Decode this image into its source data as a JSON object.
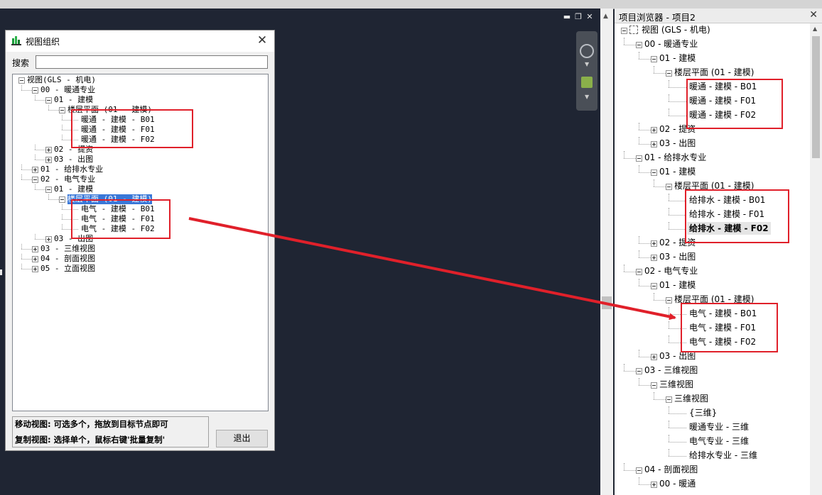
{
  "dialog": {
    "title": "视图组织",
    "close_glyph": "✕",
    "search_label": "搜索",
    "search_value": "",
    "tree": [
      {
        "label": "视图(GLS - 机电)",
        "level": 0,
        "expander": "minus"
      },
      {
        "label": "00 - 暖通专业",
        "level": 1,
        "expander": "minus"
      },
      {
        "label": "01 - 建模",
        "level": 2,
        "expander": "minus"
      },
      {
        "label": "楼层平面 (01 - 建模)",
        "level": 3,
        "expander": "minus"
      },
      {
        "label": "暖通 - 建模 - B01",
        "level": 4,
        "expander": "none"
      },
      {
        "label": "暖通 - 建模 - F01",
        "level": 4,
        "expander": "none"
      },
      {
        "label": "暖通 - 建模 - F02",
        "level": 4,
        "expander": "none"
      },
      {
        "label": "02 - 提资",
        "level": 2,
        "expander": "plus"
      },
      {
        "label": "03 - 出图",
        "level": 2,
        "expander": "plus"
      },
      {
        "label": "01 - 给排水专业",
        "level": 1,
        "expander": "plus"
      },
      {
        "label": "02 - 电气专业",
        "level": 1,
        "expander": "minus"
      },
      {
        "label": "01 - 建模",
        "level": 2,
        "expander": "minus"
      },
      {
        "label": "楼层平面 (01 - 建模)",
        "level": 3,
        "expander": "minus",
        "selected": true
      },
      {
        "label": "电气 - 建模 - B01",
        "level": 4,
        "expander": "none"
      },
      {
        "label": "电气 - 建模 - F01",
        "level": 4,
        "expander": "none"
      },
      {
        "label": "电气 - 建模 - F02",
        "level": 4,
        "expander": "none"
      },
      {
        "label": "03 - 出图",
        "level": 2,
        "expander": "plus"
      },
      {
        "label": "03 - 三维视图",
        "level": 1,
        "expander": "plus"
      },
      {
        "label": "04 - 剖面视图",
        "level": 1,
        "expander": "plus"
      },
      {
        "label": "05 - 立面视图",
        "level": 1,
        "expander": "plus"
      }
    ],
    "info_line1": "移动视图: 可选多个，拖放到目标节点即可",
    "info_line2": "复制视图: 选择单个，鼠标右键'批量复制'",
    "exit_label": "退出"
  },
  "project_browser": {
    "title": "项目浏览器 - 项目2",
    "close_glyph": "✕",
    "tree": [
      {
        "label": "视图 (GLS - 机电)",
        "level": 0,
        "expander": "minus",
        "icon": "views-icon"
      },
      {
        "label": "00 - 暖通专业",
        "level": 1,
        "expander": "minus"
      },
      {
        "label": "01 - 建模",
        "level": 2,
        "expander": "minus"
      },
      {
        "label": "楼层平面 (01 - 建模)",
        "level": 3,
        "expander": "minus"
      },
      {
        "label": "暖通 - 建模 - B01",
        "level": 4,
        "expander": "none"
      },
      {
        "label": "暖通 - 建模 - F01",
        "level": 4,
        "expander": "none"
      },
      {
        "label": "暖通 - 建模 - F02",
        "level": 4,
        "expander": "none"
      },
      {
        "label": "02 - 提资",
        "level": 2,
        "expander": "plus"
      },
      {
        "label": "03 - 出图",
        "level": 2,
        "expander": "plus"
      },
      {
        "label": "01 - 给排水专业",
        "level": 1,
        "expander": "minus"
      },
      {
        "label": "01 - 建模",
        "level": 2,
        "expander": "minus"
      },
      {
        "label": "楼层平面 (01 - 建模)",
        "level": 3,
        "expander": "minus"
      },
      {
        "label": "给排水 - 建模 - B01",
        "level": 4,
        "expander": "none"
      },
      {
        "label": "给排水 - 建模 - F01",
        "level": 4,
        "expander": "none"
      },
      {
        "label": "给排水 - 建模 - F02",
        "level": 4,
        "expander": "none",
        "bold": true
      },
      {
        "label": "02 - 提资",
        "level": 2,
        "expander": "plus"
      },
      {
        "label": "03 - 出图",
        "level": 2,
        "expander": "plus"
      },
      {
        "label": "02 - 电气专业",
        "level": 1,
        "expander": "minus"
      },
      {
        "label": "01 - 建模",
        "level": 2,
        "expander": "minus"
      },
      {
        "label": "楼层平面 (01 - 建模)",
        "level": 3,
        "expander": "minus"
      },
      {
        "label": "电气 - 建模 - B01",
        "level": 4,
        "expander": "none"
      },
      {
        "label": "电气 - 建模 - F01",
        "level": 4,
        "expander": "none"
      },
      {
        "label": "电气 - 建模 - F02",
        "level": 4,
        "expander": "none"
      },
      {
        "label": "03 - 出图",
        "level": 2,
        "expander": "plus"
      },
      {
        "label": "03 - 三维视图",
        "level": 1,
        "expander": "minus"
      },
      {
        "label": "三维视图",
        "level": 2,
        "expander": "minus"
      },
      {
        "label": "三维视图",
        "level": 3,
        "expander": "minus"
      },
      {
        "label": "{三维}",
        "level": 4,
        "expander": "none"
      },
      {
        "label": "暖通专业 - 三维",
        "level": 4,
        "expander": "none"
      },
      {
        "label": "电气专业 - 三维",
        "level": 4,
        "expander": "none"
      },
      {
        "label": "给排水专业 - 三维",
        "level": 4,
        "expander": "none"
      },
      {
        "label": "04 - 剖面视图",
        "level": 1,
        "expander": "minus"
      },
      {
        "label": "00 - 暖通",
        "level": 2,
        "expander": "plus"
      }
    ]
  },
  "colors": {
    "highlight_box": "#e0202a",
    "arrow": "#e0202a",
    "selection": "#3a78d8",
    "canvas": "#1f2533"
  }
}
